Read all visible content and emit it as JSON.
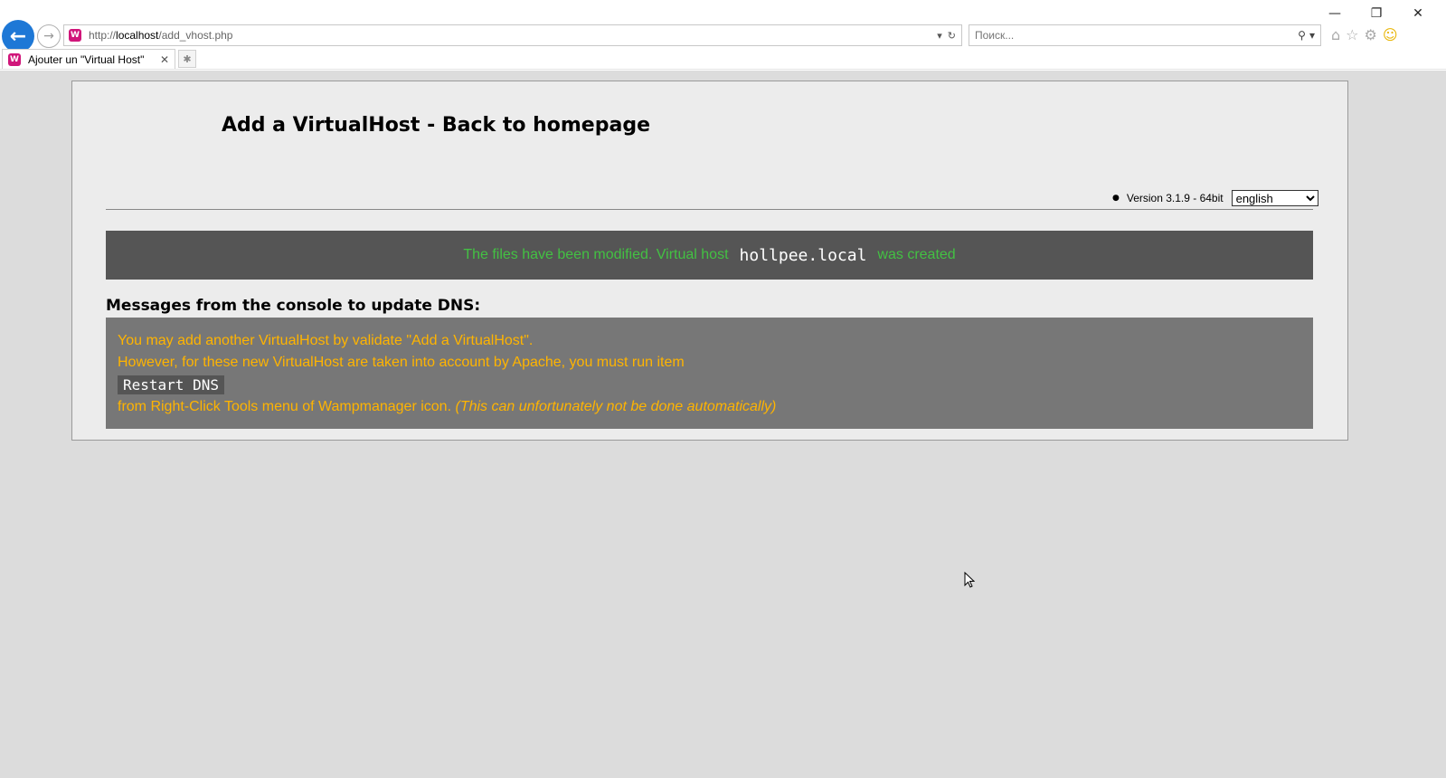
{
  "browser": {
    "address_url_prefix": "http://",
    "address_url_host": "localhost",
    "address_url_path": "/add_vhost.php",
    "search_placeholder": "Поиск...",
    "tab_title": "Ajouter un \"Virtual Host\"",
    "site_icon_letter": "W",
    "icons": [
      "back-arrow-icon",
      "forward-arrow-icon",
      "dropdown-icon",
      "refresh-icon",
      "search-icon",
      "home-icon",
      "favorites-star-icon",
      "settings-gear-icon",
      "smiley-icon",
      "close-icon",
      "new-tab-icon",
      "minimize-icon",
      "restore-icon"
    ]
  },
  "page": {
    "title": "Add a VirtualHost - Back to homepage",
    "version": "Version 3.1.9 - 64bit",
    "language_selected": "english",
    "notice": {
      "before": "The files have been modified. Virtual host",
      "host": "hollpee.local",
      "after": "was created"
    },
    "dns_heading": "Messages from the console to update DNS:",
    "dns_lines": {
      "line1": "You may add another VirtualHost by validate \"Add a VirtualHost\".",
      "line2": "However, for these new VirtualHost are taken into account by Apache, you must run item",
      "command": "Restart DNS",
      "line3": "from Right-Click Tools menu of Wampmanager icon.",
      "line3_italic": "(This can unfortunately not be done automatically)"
    }
  },
  "colors": {
    "notice_bg": "#555555",
    "notice_text": "#43c143",
    "dns_bg": "#777777",
    "dns_text": "#ffb400",
    "back_button": "#1e78d6"
  }
}
